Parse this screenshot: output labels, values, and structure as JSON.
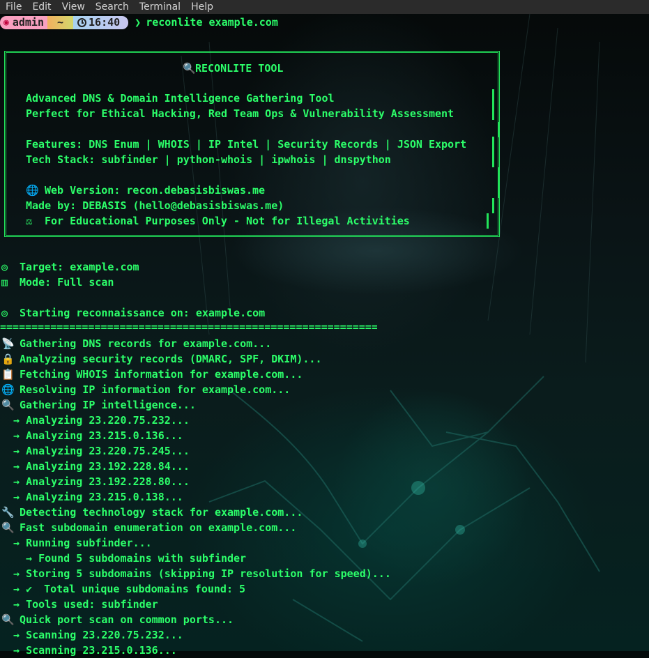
{
  "menu": [
    "File",
    "Edit",
    "View",
    "Search",
    "Terminal",
    "Help"
  ],
  "prompt": {
    "user": "admin",
    "dir": "~",
    "time": "16:40",
    "arrow": "❯",
    "command": "reconlite example.com"
  },
  "banner": {
    "title": "RECONLITE TOOL",
    "title_icon": "magnifier-icon",
    "desc1": "Advanced DNS & Domain Intelligence Gathering Tool",
    "desc2": "Perfect for Ethical Hacking, Red Team Ops & Vulnerability Assessment",
    "features": "Features: DNS Enum | WHOIS | IP Intel | Security Records | JSON Export",
    "tech": "Tech Stack: subfinder | python-whois | ipwhois | dnspython",
    "web": "Web Version: recon.debasisbiswas.me",
    "made_by": "Made by: DEBASIS (hello@debasisbiswas.me)",
    "disclaimer": "For Educational Purposes Only - Not for Illegal Activities"
  },
  "target": "Target: example.com",
  "mode": "Mode: Full scan",
  "starting": "Starting reconnaissance on: example.com",
  "separator": "==============================================================",
  "steps": {
    "dns": "Gathering DNS records for example.com...",
    "security": "Analyzing security records (DMARC, SPF, DKIM)...",
    "whois": "Fetching WHOIS information for example.com...",
    "ip_resolve": "Resolving IP information for example.com...",
    "ip_intel": "Gathering IP intelligence...",
    "analyze": [
      "Analyzing 23.220.75.232...",
      "Analyzing 23.215.0.136...",
      "Analyzing 23.220.75.245...",
      "Analyzing 23.192.228.84...",
      "Analyzing 23.192.228.80...",
      "Analyzing 23.215.0.138..."
    ],
    "tech_detect": "Detecting technology stack for example.com...",
    "subdomain": "Fast subdomain enumeration on example.com...",
    "running": "Running subfinder...",
    "found": "Found 5 subdomains with subfinder",
    "storing": "Storing 5 subdomains (skipping IP resolution for speed)...",
    "total": "Total unique subdomains found: 5",
    "tools": "Tools used: subfinder",
    "portscan": "Quick port scan on common ports...",
    "scanning": [
      "Scanning 23.220.75.232...",
      "Scanning 23.215.0.136..."
    ]
  },
  "arrow": "→",
  "colors": {
    "terminal_green": "#2cff6a",
    "border_green": "#22e35a",
    "menubar": "#2b2b2b"
  }
}
